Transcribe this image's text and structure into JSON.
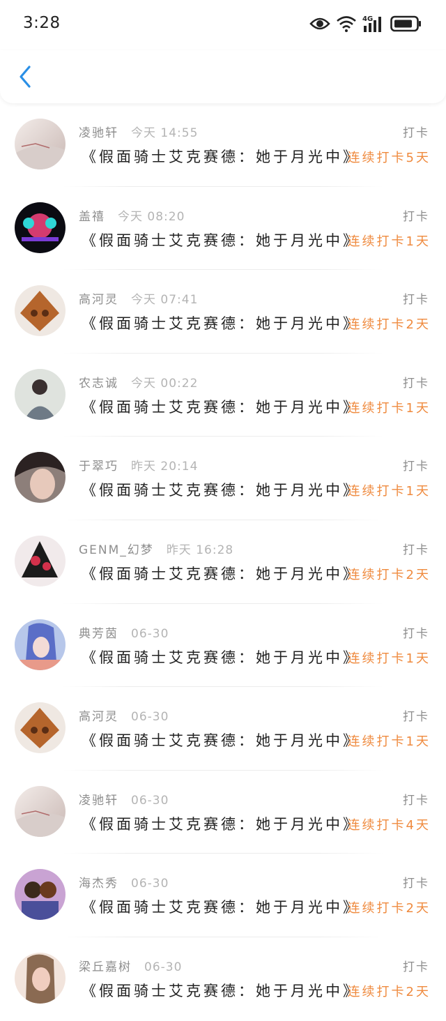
{
  "status_bar": {
    "time": "3:28",
    "network": "4G"
  },
  "colors": {
    "accent": "#2a8fe6",
    "streak": "#ef8a3e",
    "name": "#8e8e8e",
    "title": "#222222"
  },
  "nav": {
    "back_icon": "chevron-left-icon"
  },
  "entries": [
    {
      "name": "凌驰轩",
      "time": "今天 14:55",
      "action": "打卡",
      "title": "《假面骑士艾克赛德：她于月光中》",
      "streak": "连续打卡5天"
    },
    {
      "name": "盖禧",
      "time": "今天 08:20",
      "action": "打卡",
      "title": "《假面骑士艾克赛德：她于月光中》",
      "streak": "连续打卡1天"
    },
    {
      "name": "高河灵",
      "time": "今天 07:41",
      "action": "打卡",
      "title": "《假面骑士艾克赛德：她于月光中》",
      "streak": "连续打卡2天"
    },
    {
      "name": "农志诚",
      "time": "今天 00:22",
      "action": "打卡",
      "title": "《假面骑士艾克赛德：她于月光中》",
      "streak": "连续打卡1天"
    },
    {
      "name": "于翠巧",
      "time": "昨天 20:14",
      "action": "打卡",
      "title": "《假面骑士艾克赛德：她于月光中》",
      "streak": "连续打卡1天"
    },
    {
      "name": "GENM_幻梦",
      "time": "昨天 16:28",
      "action": "打卡",
      "title": "《假面骑士艾克赛德：她于月光中》",
      "streak": "连续打卡2天"
    },
    {
      "name": "典芳茵",
      "time": "06-30",
      "action": "打卡",
      "title": "《假面骑士艾克赛德：她于月光中》",
      "streak": "连续打卡1天"
    },
    {
      "name": "高河灵",
      "time": "06-30",
      "action": "打卡",
      "title": "《假面骑士艾克赛德：她于月光中》",
      "streak": "连续打卡1天"
    },
    {
      "name": "凌驰轩",
      "time": "06-30",
      "action": "打卡",
      "title": "《假面骑士艾克赛德：她于月光中》",
      "streak": "连续打卡4天"
    },
    {
      "name": "海杰秀",
      "time": "06-30",
      "action": "打卡",
      "title": "《假面骑士艾克赛德：她于月光中》",
      "streak": "连续打卡2天"
    },
    {
      "name": "梁丘嘉树",
      "time": "06-30",
      "action": "打卡",
      "title": "《假面骑士艾克赛德：她于月光中》",
      "streak": "连续打卡2天"
    }
  ]
}
